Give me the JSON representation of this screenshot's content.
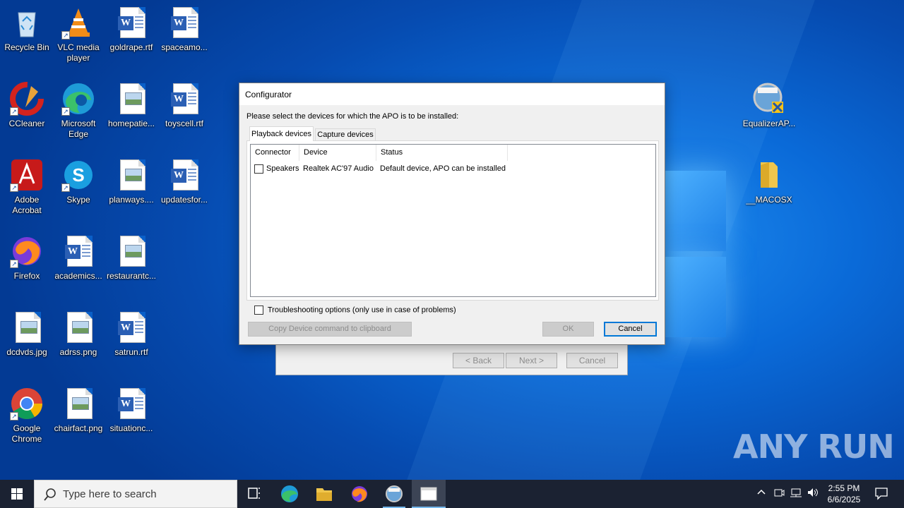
{
  "desktop_icons": [
    {
      "label": "Recycle Bin",
      "icon": "recycle-bin-icon"
    },
    {
      "label": "VLC media player",
      "icon": "vlc-icon"
    },
    {
      "label": "goldrape.rtf",
      "icon": "word-doc-icon"
    },
    {
      "label": "spaceamo...",
      "icon": "word-doc-icon"
    },
    {
      "label": "CCleaner",
      "icon": "ccleaner-icon"
    },
    {
      "label": "Microsoft Edge",
      "icon": "edge-icon"
    },
    {
      "label": "homepatie...",
      "icon": "image-file-icon"
    },
    {
      "label": "toyscell.rtf",
      "icon": "word-doc-icon"
    },
    {
      "label": "Adobe Acrobat",
      "icon": "acrobat-icon"
    },
    {
      "label": "Skype",
      "icon": "skype-icon"
    },
    {
      "label": "planways....",
      "icon": "image-file-icon"
    },
    {
      "label": "updatesfor...",
      "icon": "word-doc-icon"
    },
    {
      "label": "Firefox",
      "icon": "firefox-icon"
    },
    {
      "label": "academics...",
      "icon": "word-doc-icon"
    },
    {
      "label": "restaurantc...",
      "icon": "image-file-icon"
    },
    {
      "label": "dcdvds.jpg",
      "icon": "image-file-icon"
    },
    {
      "label": "adrss.png",
      "icon": "image-file-icon"
    },
    {
      "label": "satrun.rtf",
      "icon": "word-doc-icon"
    },
    {
      "label": "Google Chrome",
      "icon": "chrome-icon"
    },
    {
      "label": "chairfact.png",
      "icon": "image-file-icon"
    },
    {
      "label": "situationc...",
      "icon": "word-doc-icon"
    },
    {
      "label": "EqualizerAP...",
      "icon": "installer-icon"
    },
    {
      "label": "__MACOSX",
      "icon": "folder-icon"
    }
  ],
  "wizard": {
    "back_label": "< Back",
    "next_label": "Next >",
    "cancel_label": "Cancel"
  },
  "dialog": {
    "title": "Configurator",
    "prompt": "Please select the devices for which the APO is to be installed:",
    "tabs": [
      "Playback devices",
      "Capture devices"
    ],
    "columns": [
      "Connector",
      "Device",
      "Status"
    ],
    "rows": [
      {
        "connector": "Speakers",
        "device": "Realtek AC'97 Audio",
        "status": "Default device, APO can be installed",
        "checked": false
      }
    ],
    "troubleshooting_label": "Troubleshooting options (only use in case of problems)",
    "copy_button": "Copy Device command to clipboard",
    "ok_button": "OK",
    "cancel_button": "Cancel"
  },
  "watermark": "ANY RUN",
  "taskbar": {
    "search_placeholder": "Type here to search",
    "time": "2:55 PM",
    "date": "6/6/2025"
  },
  "colors": {
    "desktop_bg": "#0a6ad8",
    "taskbar_bg": "#1b2232",
    "accent": "#0078d7"
  }
}
